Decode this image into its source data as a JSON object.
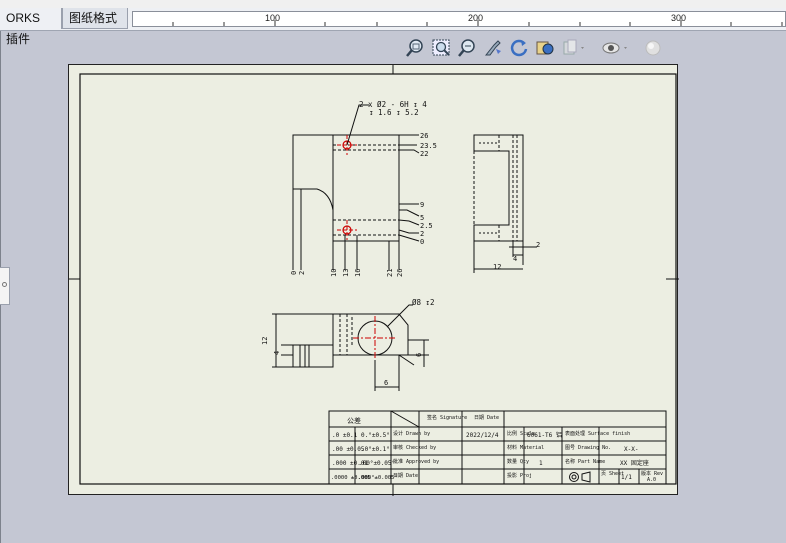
{
  "tabs": [
    {
      "label": "ORKS 插件",
      "active": false
    },
    {
      "label": "图纸格式",
      "active": true
    }
  ],
  "ruler": {
    "labels": [
      "100",
      "200",
      "300"
    ]
  },
  "view_toolbar": {
    "icons": [
      "zoom-to-fit-icon",
      "zoom-to-area-icon",
      "zoom-in-out-icon",
      "pan-icon",
      "rotate-icon",
      "redraw-icon",
      "display-style-icon",
      "hide-show-icon",
      "appearance-icon"
    ]
  },
  "drawing": {
    "top_callout_line1": "2 x Ø2 - 6H ↧ 4",
    "top_callout_line2": "↧ 1.6 ↧ 5.2",
    "right_dims": [
      "26",
      "23.5",
      "22",
      "9",
      "5",
      "2.5",
      "2",
      "0"
    ],
    "bottom_dims": [
      "0",
      "2",
      "10",
      "13",
      "16",
      "21",
      "26"
    ],
    "side_dims": [
      "2",
      "4",
      "12"
    ],
    "hole_callout": "Ø8 ↧2",
    "front_dims": [
      "12",
      "4",
      "6",
      "6"
    ]
  },
  "title_block": {
    "tolerance_header": "公差",
    "tol_rows": [
      [
        ".0 ±0.1",
        "0.°±0.5°"
      ],
      [
        ".00 ±0.05",
        ".0°±0.1°"
      ],
      [
        ".000 ±0.01",
        ".00°±0.05°"
      ],
      [
        ".0000 ±0.005",
        ".000°±0.005°"
      ]
    ],
    "role_labels": [
      "设计\nDrawn by",
      "审核\nChecked by",
      "批准\nApproved by",
      "日期\nDate"
    ],
    "name_header": "签名\nSignature",
    "date_header": "日期\nDate",
    "date_value": "2022/12/4",
    "scale_label": "比例\nScale",
    "scale_value": "2:1",
    "material_label": "材料\nMaterial",
    "material_value": "6061-T6 铝",
    "finish_label": "表面处理\nSurface finish",
    "qty_label": "数量\nQty",
    "qty_value": "1",
    "projection_label": "投影\nProj",
    "drawing_no_label": "图号\nDrawing No.",
    "drawing_no_value": "X-X-",
    "part_name_label": "名称\nPart Name",
    "part_name_value": "XX 固定座",
    "sheet_label": "页\nSheet",
    "sheet_value": "1/1",
    "rev_label": "版本\nRev",
    "rev_value": "A.0"
  }
}
